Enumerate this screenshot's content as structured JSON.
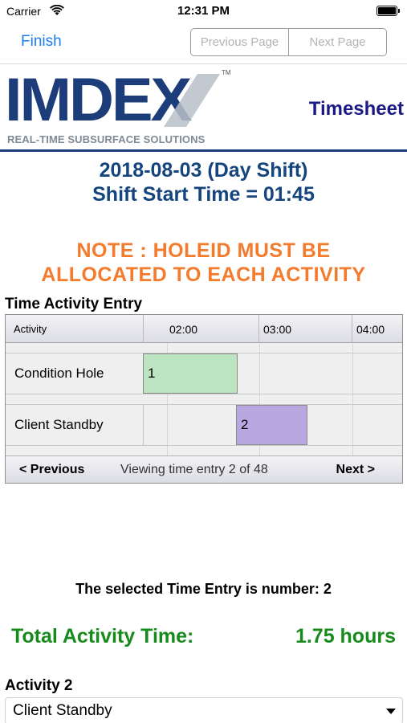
{
  "status_bar": {
    "carrier": "Carrier",
    "time": "12:31 PM",
    "wifi_icon": "wifi-icon",
    "battery_icon": "battery-icon"
  },
  "nav": {
    "finish_label": "Finish",
    "previous_page_label": "Previous Page",
    "next_page_label": "Next Page"
  },
  "header": {
    "logo_text": "IMDEX",
    "logo_tm": "TM",
    "logo_tagline": "REAL-TIME SUBSURFACE SOLUTIONS",
    "title": "Timesheet"
  },
  "shift": {
    "date_line": "2018-08-03 (Day Shift)",
    "start_line": "Shift Start Time = 01:45"
  },
  "note": {
    "line1": "NOTE : HOLEID MUST BE",
    "line2": "ALLOCATED TO EACH ACTIVITY"
  },
  "time_activity": {
    "section_title": "Time Activity Entry",
    "columns": [
      "Activity",
      "02:00",
      "03:00",
      "04:00"
    ],
    "rows": [
      {
        "activity": "Condition Hole",
        "entry_number": "1"
      },
      {
        "activity": "Client Standby",
        "entry_number": "2"
      }
    ],
    "footer": {
      "previous_label": "< Previous",
      "viewing_text": "Viewing time entry 2 of 48",
      "next_label": "Next >"
    }
  },
  "summary": {
    "selected_text": "The selected Time Entry is number: 2",
    "total_label": "Total Activity Time:",
    "total_value": "1.75 hours"
  },
  "activity_detail": {
    "label": "Activity 2",
    "selected_value": "Client Standby"
  },
  "colors": {
    "accent_blue": "#1e7cf2",
    "heading_blue": "#14457e",
    "note_orange": "#f47a2c",
    "total_green": "#168a1b",
    "bar_green": "#bde4c0",
    "bar_purple": "#b9a7e2"
  }
}
